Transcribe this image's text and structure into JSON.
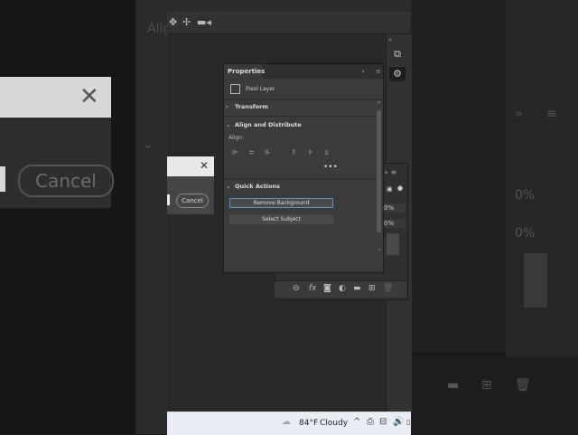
{
  "background_left": {
    "dialog_cancel_label": "Cancel",
    "close_glyph": "✕",
    "faint_text": "Alig"
  },
  "background_right": {
    "pct_1": "0%",
    "pct_2": "0%"
  },
  "bg_dialog": {
    "close_glyph": "✕",
    "cancel_label": "Cancel"
  },
  "layers_panel": {
    "header_glyphs": "» ≡",
    "opacity_pct": "0%",
    "fill_pct": "0%",
    "footer_icons": [
      "link-icon",
      "fx-icon",
      "mask-icon",
      "adjustment-icon",
      "folder-icon",
      "new-layer-icon",
      "trash-icon"
    ]
  },
  "properties": {
    "tab_label": "Properties",
    "layer_type": "Pixel Layer",
    "sections": {
      "transform": "Transform",
      "align": "Align and Distribute",
      "quick_actions": "Quick Actions"
    },
    "align_label": "Align:",
    "more_glyph": "•••",
    "buttons": {
      "remove_bg": "Remove Background",
      "select_subject": "Select Subject"
    }
  },
  "taskbar": {
    "weather_temp": "84°F",
    "weather_desc": "Cloudy",
    "chevron": "^"
  },
  "colors": {
    "panel_bg": "#3b3b3b",
    "app_bg": "#2b2b2b",
    "highlight_border": "#6a8fd0",
    "taskbar_bg": "#e9eef5"
  }
}
